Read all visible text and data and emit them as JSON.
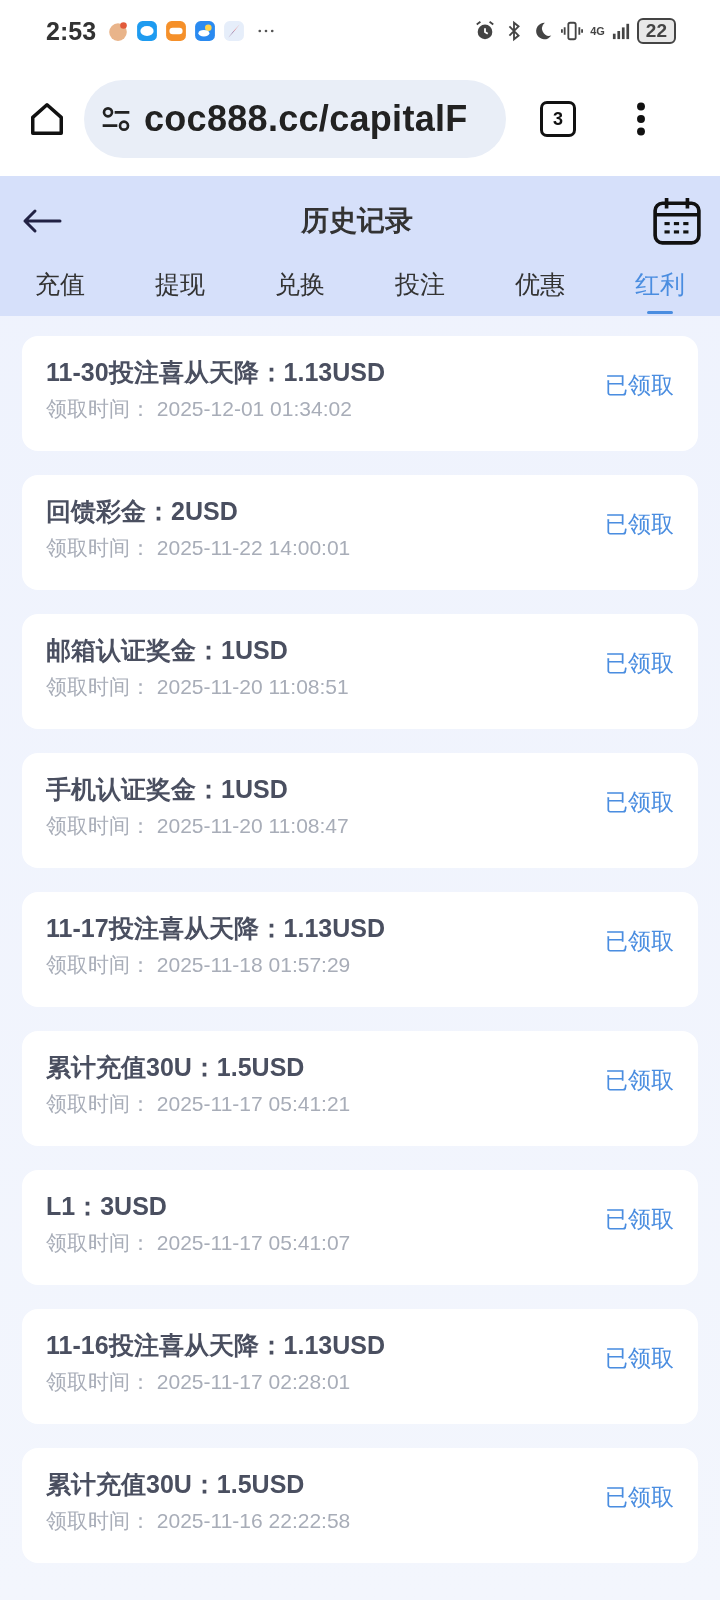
{
  "status_bar": {
    "time": "2:53",
    "network": "4G",
    "battery": "22"
  },
  "browser": {
    "url": "coc888.cc/capitalF",
    "tab_count": "3"
  },
  "header": {
    "title": "历史记录"
  },
  "tabs": [
    {
      "label": "充值",
      "selected": false
    },
    {
      "label": "提现",
      "selected": false
    },
    {
      "label": "兑换",
      "selected": false
    },
    {
      "label": "投注",
      "selected": false
    },
    {
      "label": "优惠",
      "selected": false
    },
    {
      "label": "红利",
      "selected": true
    }
  ],
  "records": [
    {
      "title": "11-30投注喜从天降：1.13USD",
      "time_label": "领取时间：",
      "time": "2025-12-01 01:34:02",
      "status": "已领取"
    },
    {
      "title": "回馈彩金：2USD",
      "time_label": "领取时间：",
      "time": "2025-11-22 14:00:01",
      "status": "已领取"
    },
    {
      "title": "邮箱认证奖金：1USD",
      "time_label": "领取时间：",
      "time": "2025-11-20 11:08:51",
      "status": "已领取"
    },
    {
      "title": "手机认证奖金：1USD",
      "time_label": "领取时间：",
      "time": "2025-11-20 11:08:47",
      "status": "已领取"
    },
    {
      "title": "11-17投注喜从天降：1.13USD",
      "time_label": "领取时间：",
      "time": "2025-11-18 01:57:29",
      "status": "已领取"
    },
    {
      "title": "累计充值30U：1.5USD",
      "time_label": "领取时间：",
      "time": "2025-11-17 05:41:21",
      "status": "已领取"
    },
    {
      "title": "L1：3USD",
      "time_label": "领取时间：",
      "time": "2025-11-17 05:41:07",
      "status": "已领取"
    },
    {
      "title": "11-16投注喜从天降：1.13USD",
      "time_label": "领取时间：",
      "time": "2025-11-17 02:28:01",
      "status": "已领取"
    },
    {
      "title": "累计充值30U：1.5USD",
      "time_label": "领取时间：",
      "time": "2025-11-16 22:22:58",
      "status": "已领取"
    }
  ]
}
